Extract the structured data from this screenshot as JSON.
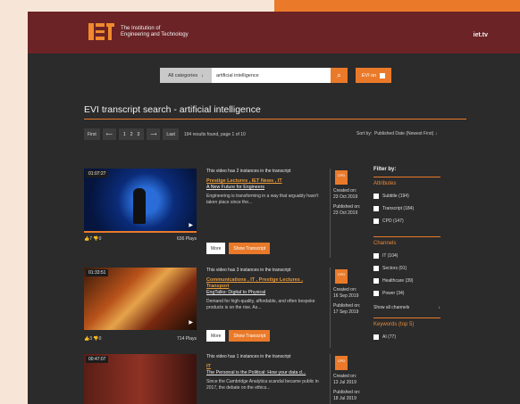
{
  "header": {
    "logo_line1": "The Institution of",
    "logo_line2": "Engineering and Technology",
    "site": "iet.tv"
  },
  "search": {
    "category": "All categories",
    "query": "artificial intelligence",
    "evi_label": "EVI on"
  },
  "page_title": "EVI transcript search - artificial intelligence",
  "pager": {
    "first": "First",
    "prev": "⟵",
    "pages": [
      "1",
      "2",
      "3"
    ],
    "next": "⟶",
    "last": "Last",
    "results": "194 results found, page 1 of 10"
  },
  "sort": {
    "label": "Sort by:",
    "value": "Published Date (Newest First)"
  },
  "results": [
    {
      "time": "01:07:27",
      "instances": "This video has 2 instances in the transcript",
      "tags": "Prestige Lectures , IET News , IT",
      "title": "A New Future for Engineers",
      "desc": "Engineering is transforming in a way that arguably hasn't taken place since the...",
      "likes": "7",
      "dislikes": "0",
      "plays": "636 Plays",
      "badge": "CPD",
      "created_label": "Created on:",
      "created": "23 Oct 2019",
      "published_label": "Published on:",
      "published": "23 Oct 2019"
    },
    {
      "time": "01:33:51",
      "instances": "This video has 3 instances in the transcript",
      "tags": "Communications , IT , Prestige Lectures , Transport",
      "title": "EngTalks: Digital to Physical",
      "desc": "Demand for high-quality, affordable, and often bespoke products is on the rise. As...",
      "likes": "3",
      "dislikes": "0",
      "plays": "714 Plays",
      "badge": "CPD",
      "created_label": "Created on:",
      "created": "16 Sep 2019",
      "published_label": "Published on:",
      "published": "17 Sep 2019"
    },
    {
      "time": "00:47:07",
      "instances": "This video has 1 instances in the transcript",
      "tags": "IT",
      "title": "The Personal is the Political: How your data d...",
      "desc": "Since the Cambridge Analytica scandal became public in 2017, the debate on the ethics...",
      "badge": "CPD",
      "created_label": "Created on:",
      "created": "13 Jul 2019",
      "published_label": "Published on:",
      "published": "18 Jul 2019"
    }
  ],
  "buttons": {
    "more": "More",
    "transcript": "Show Transcript"
  },
  "filter": {
    "heading": "Filter by:",
    "attributes_label": "Attributes",
    "attributes": [
      "Subtitle (194)",
      "Transcript (184)",
      "CPD (147)"
    ],
    "channels_label": "Channels",
    "channels": [
      "IT (104)",
      "Sectors (91)",
      "Healthcare (39)",
      "Power (34)"
    ],
    "show_all": "Show all channels",
    "keywords_label": "Keywords (top 5)",
    "keywords": [
      "AI (77)"
    ]
  }
}
